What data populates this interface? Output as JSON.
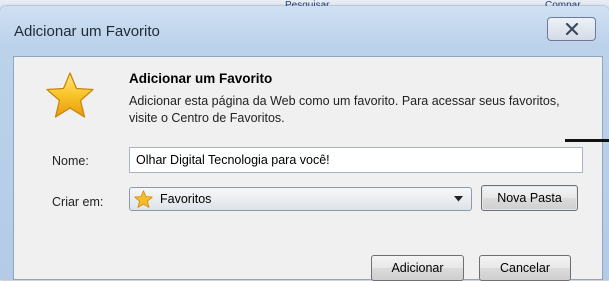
{
  "background": {
    "text1": "Pesquisar",
    "text2": "Compar"
  },
  "window": {
    "title": "Adicionar um Favorito",
    "close_icon": "close-icon"
  },
  "dialog": {
    "icon": "favorites-star-icon",
    "heading": "Adicionar um Favorito",
    "description": "Adicionar esta página da Web como um favorito. Para acessar seus favoritos, visite o Centro de Favoritos.",
    "name_label": "Nome:",
    "name_value": "Olhar Digital Tecnologia para você!",
    "create_in_label": "Criar em:",
    "create_in_value": "Favoritos",
    "create_in_icon": "favorites-star-icon",
    "new_folder_button": "Nova Pasta",
    "add_button": "Adicionar",
    "cancel_button": "Cancelar"
  },
  "colors": {
    "title_bar": "#bcd2ea",
    "panel": "#f0f0f0",
    "star": "#f5b81f"
  }
}
